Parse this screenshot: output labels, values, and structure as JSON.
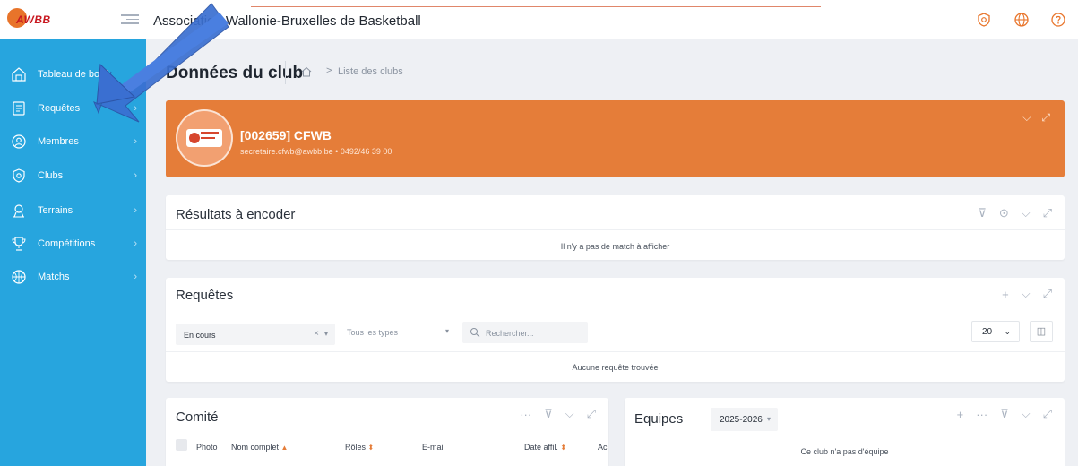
{
  "header": {
    "logo_text": "AWBB",
    "app_title": "Association Wallonie-Bruxelles de Basketball",
    "icons": [
      "shield-badge-icon",
      "globe-icon",
      "help-icon"
    ]
  },
  "sidebar": {
    "items": [
      {
        "label": "Tableau de bord",
        "icon": "dashboard-icon"
      },
      {
        "label": "Requêtes",
        "icon": "requests-icon"
      },
      {
        "label": "Membres",
        "icon": "members-icon"
      },
      {
        "label": "Clubs",
        "icon": "clubs-icon"
      },
      {
        "label": "Terrains",
        "icon": "map-pin-icon"
      },
      {
        "label": "Compétitions",
        "icon": "trophy-icon"
      },
      {
        "label": "Matchs",
        "icon": "basketball-icon"
      }
    ]
  },
  "page": {
    "title": "Données du club",
    "breadcrumb_current": "Liste des clubs"
  },
  "club": {
    "name": "[002659] CFWB",
    "contact": "secretaire.cfwb@awbb.be • 0492/46 39 00"
  },
  "results": {
    "title": "Résultats à encoder",
    "empty": "Il n'y a pas de match à afficher"
  },
  "requests": {
    "title": "Requêtes",
    "status_value": "En cours",
    "type_placeholder": "Tous les types",
    "search_placeholder": "Rechercher...",
    "page_size": "20",
    "empty": "Aucune requête trouvée"
  },
  "committee": {
    "title": "Comité",
    "columns": [
      "Photo",
      "Nom complet",
      "Rôles",
      "E-mail",
      "Date affil.",
      "Ac"
    ]
  },
  "teams": {
    "title": "Equipes",
    "season": "2025-2026",
    "empty": "Ce club n'a pas d'équipe"
  },
  "colors": {
    "sidebar": "#27a5de",
    "banner": "#e57d39",
    "arrow": "#3a6fd1"
  }
}
